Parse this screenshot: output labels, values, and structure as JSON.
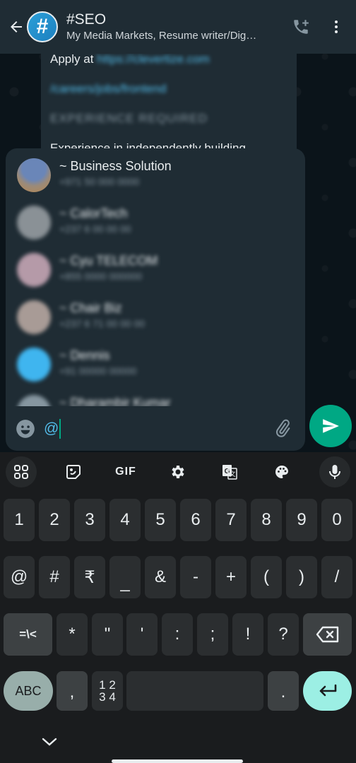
{
  "header": {
    "title": "#SEO",
    "subtitle": "My Media Markets, Resume writer/Dig…",
    "avatar_glyph": "#",
    "icons": [
      "back-arrow-icon",
      "add-call-icon",
      "more-vertical-icon"
    ]
  },
  "message": {
    "line1_prefix": "Apply at",
    "line1_link": "https://clevertize.com",
    "line2_link": "/careers/jobs/frontend",
    "heading": "EXPERIENCE REQUIRED",
    "body": "Experience in independently building"
  },
  "mentions": [
    {
      "name": "~ Business Solution",
      "phone": "+971 50 000 0000",
      "avatar_color": "#6a7f9c"
    },
    {
      "name": "~ CalorTech",
      "phone": "+237 6 00 00 00",
      "avatar_color": "#8a9196"
    },
    {
      "name": "~ Cyu TELECOM",
      "phone": "+855 0000 000000",
      "avatar_color": "#b59aa8"
    },
    {
      "name": "~ Chair Biz",
      "phone": "+237 6 71 00 00 00",
      "avatar_color": "#a89b96"
    },
    {
      "name": "~ Dennis",
      "phone": "+91 00000 00000",
      "avatar_color": "#3fb5ef"
    },
    {
      "name": "~ Dharambir Kumar",
      "phone": "",
      "avatar_color": "#8696a0"
    }
  ],
  "composer": {
    "value": "@",
    "icons": [
      "emoji-icon",
      "attach-icon",
      "send-icon"
    ]
  },
  "keyboard": {
    "toolbar": [
      "apps-grid-icon",
      "sticker-icon",
      "GIF",
      "settings-gear-icon",
      "translate-icon",
      "palette-icon",
      "microphone-icon"
    ],
    "gif_label": "GIF",
    "row1": [
      "1",
      "2",
      "3",
      "4",
      "5",
      "6",
      "7",
      "8",
      "9",
      "0"
    ],
    "row2": [
      "@",
      "#",
      "₹",
      "_",
      "&",
      "-",
      "+",
      "(",
      ")",
      "/"
    ],
    "row3": [
      "=\\<",
      "*",
      "\"",
      "'",
      ":",
      ";",
      "!",
      "?"
    ],
    "row4": {
      "abc": "ABC",
      "comma": ",",
      "numpad_top": "1 2",
      "numpad_bottom": "3 4",
      "period": "."
    },
    "colors": {
      "enter": "#9cefe4",
      "abc": "#98aeaa",
      "key": "#2b2e30"
    }
  },
  "colors": {
    "header_bg": "#1f2c34",
    "accent": "#00a884",
    "link": "#53bdeb"
  }
}
